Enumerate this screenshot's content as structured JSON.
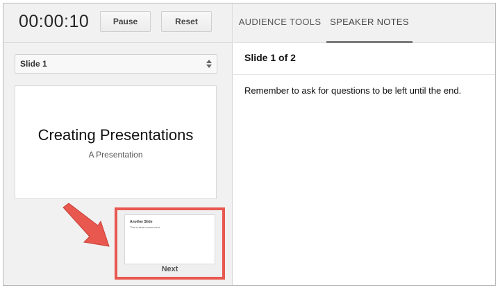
{
  "timer": {
    "value": "00:00:10"
  },
  "controls": {
    "pause_label": "Pause",
    "reset_label": "Reset"
  },
  "slide_selector": {
    "selected": "Slide 1",
    "icon": "updown-arrows-icon"
  },
  "current_slide": {
    "title": "Creating Presentations",
    "subtitle": "A Presentation"
  },
  "next_slide": {
    "thumbnail_title": "Another Slide",
    "thumbnail_body": "This is what comes next.",
    "label": "Next"
  },
  "tabs": [
    {
      "label": "AUDIENCE TOOLS",
      "active": false
    },
    {
      "label": "SPEAKER NOTES",
      "active": true
    }
  ],
  "notes": {
    "slide_count": "Slide 1 of 2",
    "text": "Remember to ask for questions to be left until the end."
  },
  "colors": {
    "highlight": "#e8584f",
    "active_tab_underline": "#7a7a7a"
  }
}
